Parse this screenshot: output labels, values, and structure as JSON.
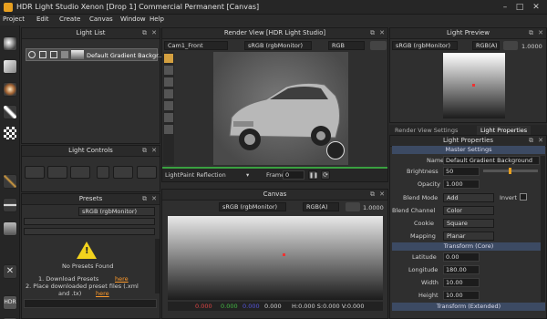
{
  "window": {
    "title": "HDR Light Studio Xenon [Drop 1]  Commercial Permanent [Canvas]",
    "minimize": "–",
    "maximize": "□",
    "close": "✕"
  },
  "menu": [
    "Project",
    "Edit",
    "Create",
    "Canvas",
    "Window",
    "Help"
  ],
  "light_list": {
    "title": "Light List",
    "item_label": "Default Gradient Backgr..."
  },
  "light_controls": {
    "title": "Light Controls"
  },
  "presets": {
    "title": "Presets",
    "colorspace": "sRGB (rgbMonitor)",
    "no_presets": "No Presets Found",
    "step1": "1. Download Presets",
    "here1": "here",
    "step2": "2. Place downloaded preset files (.xml",
    "step2b": "and .tx)",
    "here2": "here"
  },
  "render_view": {
    "title": "Render View [HDR Light Studio]",
    "camera": "Cam1_Front",
    "colorspace": "sRGB (rgbMonitor)",
    "channel": "RGB",
    "mode": "LightPaint Reflection",
    "frame_label": "Frame",
    "frame_value": "0"
  },
  "canvas": {
    "title": "Canvas",
    "colorspace": "sRGB (rgbMonitor)",
    "channel": "RGB(A)",
    "value": "1.0000",
    "status_vals": [
      "0.000",
      "0.000",
      "0.000",
      "0.000"
    ],
    "status_coords": "H:0.000  S:0.000  V:0.000"
  },
  "light_preview": {
    "title": "Light Preview",
    "colorspace": "sRGB (rgbMonitor)",
    "channel": "RGB(A)",
    "value": "1.0000"
  },
  "tabs": {
    "render_settings": "Render View Settings",
    "light_properties": "Light Properties"
  },
  "light_properties": {
    "title": "Light Properties",
    "master": "Master Settings",
    "name_label": "Name",
    "name_value": "Default Gradient Background",
    "brightness_label": "Brightness",
    "brightness_value": "50",
    "opacity_label": "Opacity",
    "opacity_value": "1.000",
    "blend_mode_label": "Blend Mode",
    "blend_mode_value": "Add",
    "invert_label": "Invert",
    "blend_channel_label": "Blend Channel",
    "blend_channel_value": "Color",
    "cookie_label": "Cookie",
    "cookie_value": "Square",
    "mapping_label": "Mapping",
    "mapping_value": "Planar",
    "transform_core": "Transform (Core)",
    "latitude_label": "Latitude",
    "latitude_value": "0.00",
    "longitude_label": "Longitude",
    "longitude_value": "180.00",
    "width_label": "Width",
    "width_value": "10.00",
    "height_label": "Height",
    "height_value": "10.00",
    "transform_extended": "Transform (Extended)"
  },
  "colors": {
    "accent_orange": "#e8a020",
    "section_blue": "#3c4a63",
    "panel": "#2f2f2f"
  },
  "sidebar_label": "HDR"
}
